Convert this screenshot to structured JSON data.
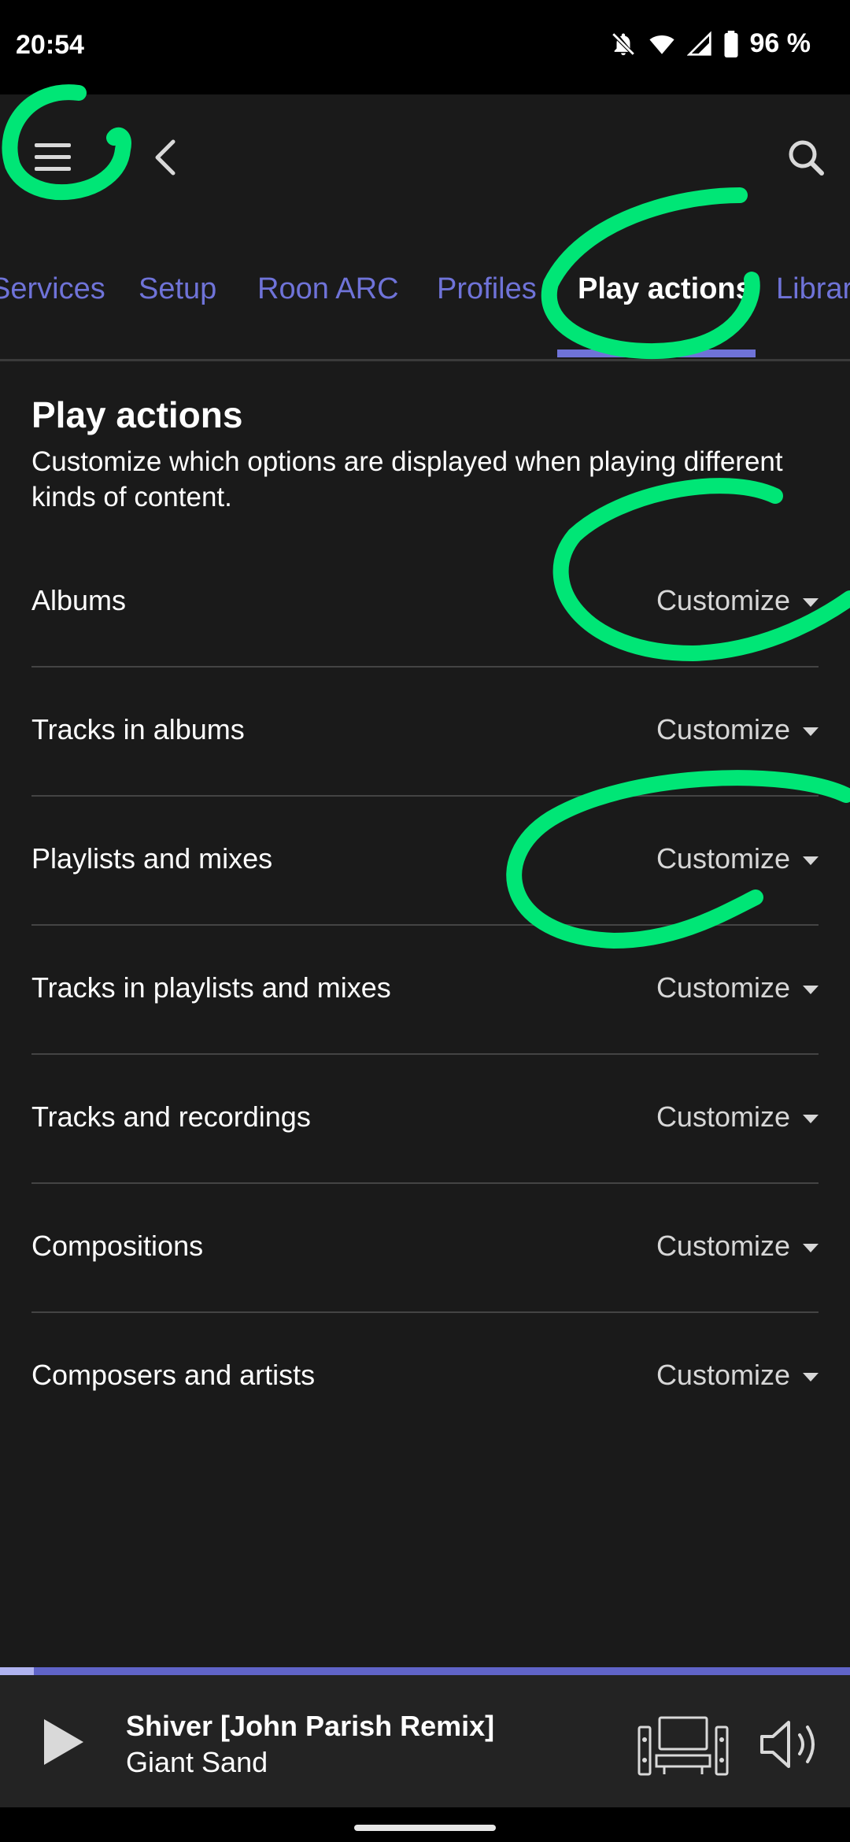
{
  "status_bar": {
    "time": "20:54",
    "battery": "96 %"
  },
  "tabs": [
    {
      "label": "Services",
      "active": false
    },
    {
      "label": "Setup",
      "active": false
    },
    {
      "label": "Roon ARC",
      "active": false
    },
    {
      "label": "Profiles",
      "active": false
    },
    {
      "label": "Play actions",
      "active": true
    },
    {
      "label": "Library",
      "active": false
    }
  ],
  "section": {
    "title": "Play actions",
    "description": "Customize which options are displayed when playing different kinds of content."
  },
  "rows": [
    {
      "label": "Albums",
      "action": "Customize"
    },
    {
      "label": "Tracks in albums",
      "action": "Customize"
    },
    {
      "label": "Playlists and mixes",
      "action": "Customize"
    },
    {
      "label": "Tracks in playlists and mixes",
      "action": "Customize"
    },
    {
      "label": "Tracks and recordings",
      "action": "Customize"
    },
    {
      "label": "Compositions",
      "action": "Customize"
    },
    {
      "label": "Composers and artists",
      "action": "Customize"
    }
  ],
  "now_playing": {
    "title": "Shiver [John Parish Remix]",
    "artist": "Giant Sand",
    "progress": 0.04
  },
  "colors": {
    "accent": "#6f73d8",
    "background": "#1a1a1a",
    "annotation": "#00e676"
  },
  "icons": [
    "menu-icon",
    "back-icon",
    "search-icon",
    "play-icon",
    "zone-icon",
    "volume-icon",
    "caret-down-icon"
  ]
}
